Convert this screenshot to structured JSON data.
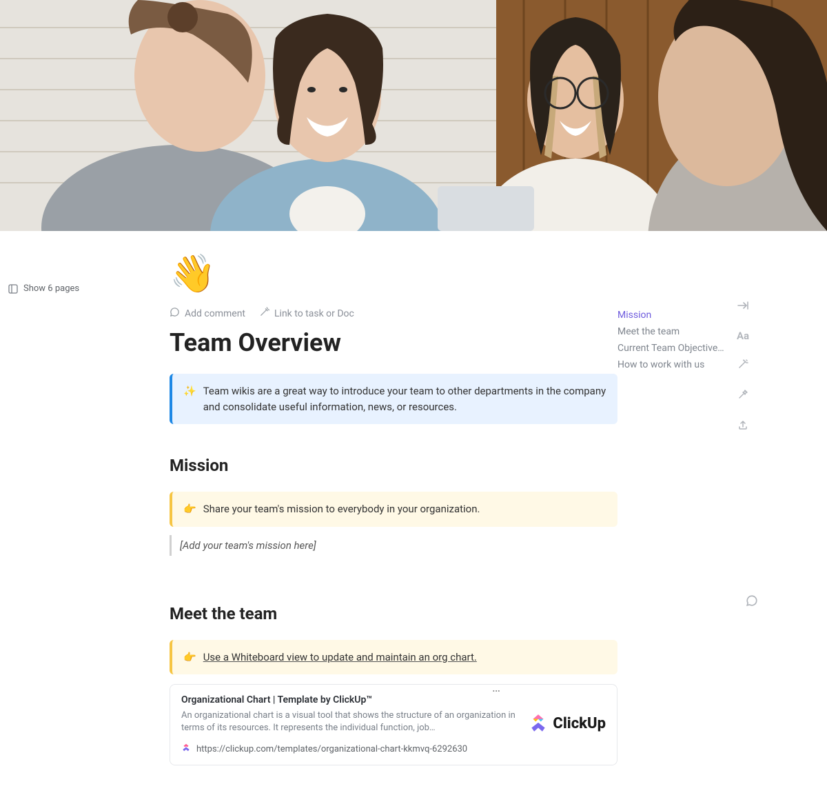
{
  "sidebar": {
    "show_pages_label": "Show 6 pages"
  },
  "header": {
    "emoji": "👋",
    "add_comment_label": "Add comment",
    "link_task_label": "Link to task or Doc",
    "title": "Team Overview"
  },
  "intro_callout": {
    "icon": "✨",
    "text": "Team wikis are a great way to introduce your team to other departments in the company and consolidate useful information, news, or resources."
  },
  "sections": {
    "mission": {
      "heading": "Mission",
      "callout_icon": "👉",
      "callout_text": "Share your team's mission to everybody in your organization.",
      "placeholder": "[Add your team's mission here]"
    },
    "meet_team": {
      "heading": "Meet the team",
      "callout_icon": "👉",
      "callout_text": "Use a Whiteboard view to update and maintain an org chart."
    }
  },
  "card": {
    "title": "Organizational Chart | Template by ClickUp™",
    "desc": "An organizational chart is a visual tool that shows the structure of an organization in terms of its resources. It represents the individual function, job…",
    "url": "https://clickup.com/templates/organizational-chart-kkmvq-6292630",
    "brand": "ClickUp",
    "more": "…"
  },
  "outline": [
    {
      "label": "Mission",
      "active": true
    },
    {
      "label": "Meet the team",
      "active": false
    },
    {
      "label": "Current Team Objective…",
      "active": false
    },
    {
      "label": "How to work with us",
      "active": false
    }
  ],
  "tools": {
    "collapse": "collapse-icon",
    "font": "Aa",
    "ai1": "wand-icon",
    "ai2": "sparkle-icon",
    "export": "export-icon"
  }
}
